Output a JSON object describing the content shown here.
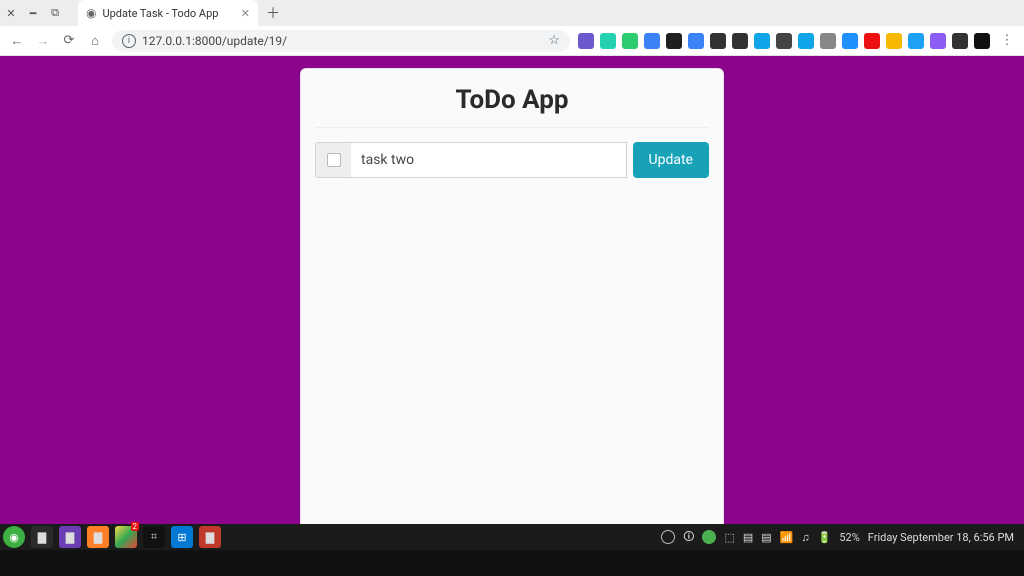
{
  "window": {
    "tab_title": "Update Task - Todo App",
    "url": "127.0.0.1:8000/update/19/"
  },
  "page": {
    "heading": "ToDo App",
    "task_value": "task two",
    "update_label": "Update"
  },
  "taskbar": {
    "battery": "52%",
    "datetime": "Friday September 18, 6:56 PM"
  },
  "ext_colors": [
    "#6a5acd",
    "#25d1b0",
    "#2ecc71",
    "#3b82f6",
    "#1f1f1f",
    "#3b82f6",
    "#333",
    "#333",
    "#0ea5e9",
    "#444",
    "#0ea5e9",
    "#888",
    "#1e90ff",
    "#e11",
    "#f6b800",
    "#1da1f2",
    "#8b5cf6",
    "#333",
    "#111"
  ]
}
